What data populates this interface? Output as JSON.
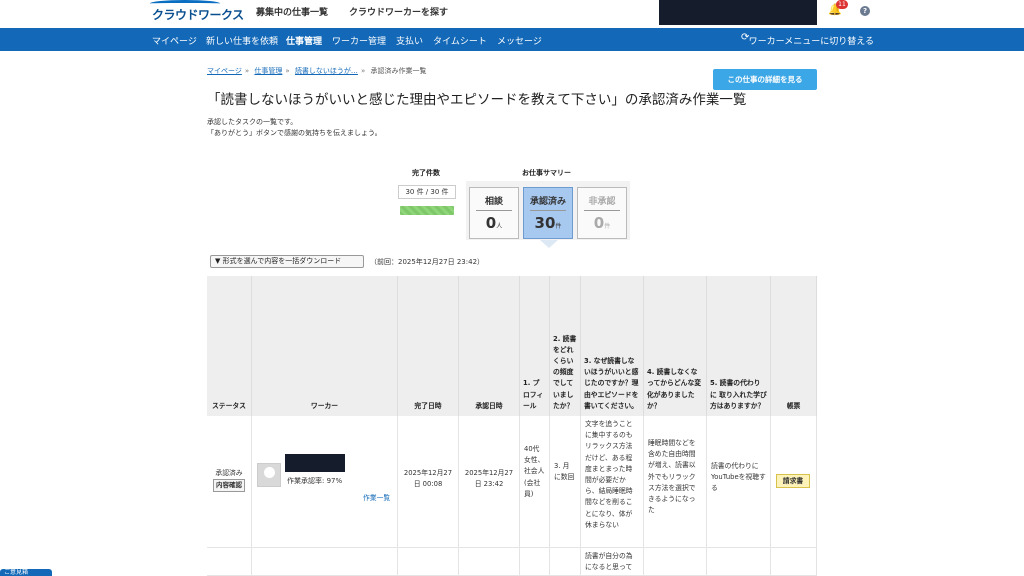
{
  "header": {
    "logo": "クラウドワークス",
    "nav": [
      "募集中の仕事一覧",
      "クラウドワーカーを探す"
    ],
    "notification_count": "11",
    "help_label": "?"
  },
  "mainnav": {
    "items": [
      "マイページ",
      "新しい仕事を依頼",
      "仕事管理",
      "ワーカー管理",
      "支払い",
      "タイムシート",
      "メッセージ"
    ],
    "switch_label": "ワーカーメニューに切り替える"
  },
  "breadcrumb": [
    "マイページ",
    "仕事管理",
    "読書しないほうが…",
    "承認済み作業一覧"
  ],
  "detail_button": "この仕事の詳細を見る",
  "page_title": "「読書しないほうがいいと感じた理由やエピソードを教えて下さい」の承認済み作業一覧",
  "description": [
    "承認したタスクの一覧です。",
    "「ありがとう」ボタンで感謝の気持ちを伝えましょう。"
  ],
  "summary": {
    "completed_label": "完了件数",
    "completed_value": "30 件 / 30 件",
    "completed_progress": 1.0,
    "summary_label": "お仕事サマリー",
    "cards": [
      {
        "title": "相談",
        "value": "0",
        "unit": "人"
      },
      {
        "title": "承認済み",
        "value": "30",
        "unit": "件"
      },
      {
        "title": "非承認",
        "value": "0",
        "unit": "件"
      }
    ]
  },
  "download": {
    "select_label": "▼ 形式を選んで内容を一括ダウンロード",
    "last_note": "（前回：2025年12月27日 23:42）"
  },
  "table": {
    "headers": [
      "ステータス",
      "ワーカー",
      "完了日時",
      "承認日時",
      "1. プロフィール",
      "2. 読書をどれくらいの頻度でしていましたか？",
      "3. なぜ読書しないほうがいいと感じたのですか？理由やエピソードを書いてください。",
      "4. 読書しなくなってからどんな変化がありましたか？",
      "5. 読書の代わりに 取り入れた学び方はありますか？",
      "帳票"
    ],
    "row1": {
      "status": "承認済み",
      "status_badge": "内容確認",
      "worker_rate": "作業承認率: 97%",
      "worker_link": "作業一覧",
      "completed": "2025年12月27日 00:08",
      "approved": "2025年12月27日 23:42",
      "profile": "40代 女性、社会人(会社員)",
      "frequency": "3. 月に数回",
      "reason": "文字を追うことに集中するのもリラックス方法だけど、ある程度まとまった時間が必要だから、結局睡眠時間などを削ることになり、体が休まらない",
      "change": "睡眠時間などを含めた自由時間が増え、読書以外でもリラックス方法を選択できるようになった",
      "alternative": "読書の代わりにYouTubeを視聴する",
      "invoice": "請求書"
    },
    "row2": {
      "reason": "読書が自分の為になると思って"
    }
  },
  "help_tab": "ご意見箱"
}
